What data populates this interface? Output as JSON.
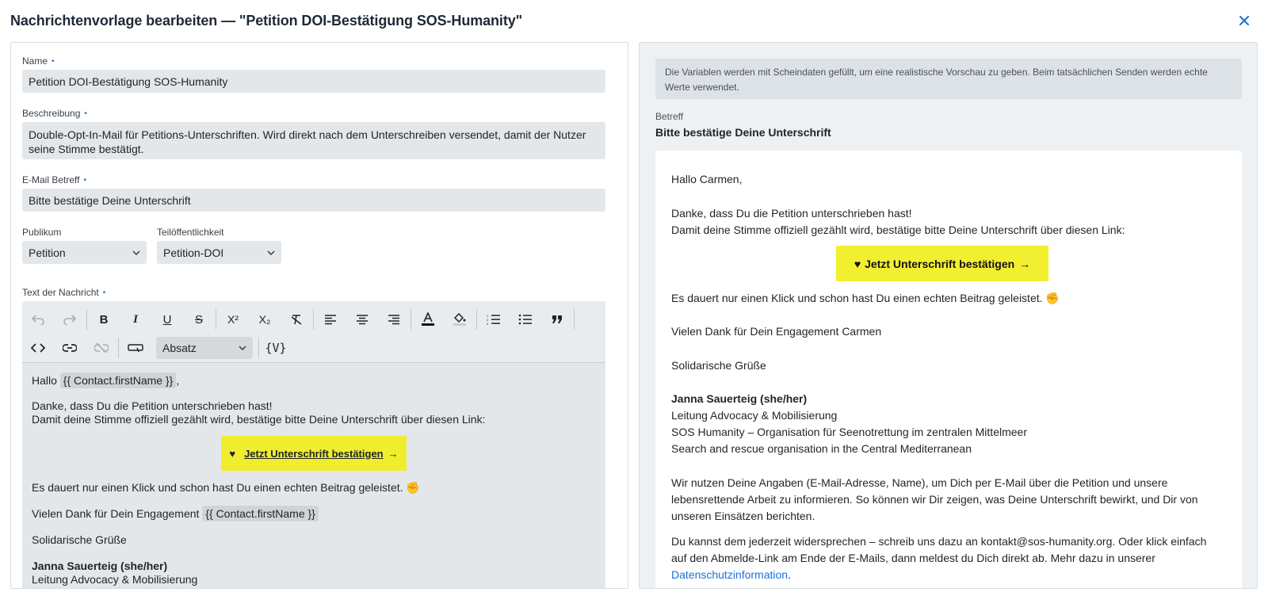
{
  "modal": {
    "title": "Nachrichtenvorlage bearbeiten — \"Petition DOI-Bestätigung SOS-Humanity\"",
    "close_label": "×"
  },
  "form": {
    "name": {
      "label": "Name",
      "value": "Petition DOI-Bestätigung SOS-Humanity"
    },
    "description": {
      "label": "Beschreibung",
      "value": "Double-Opt-In-Mail für Petitions-Unterschriften. Wird direkt nach dem Unterschreiben versendet, damit der Nutzer seine Stimme bestätigt."
    },
    "subject": {
      "label": "E-Mail Betreff",
      "value": "Bitte bestätige Deine Unterschrift"
    },
    "audience": {
      "label": "Publikum",
      "value": "Petition"
    },
    "visibility": {
      "label": "Teilöffentlichkeit",
      "value": "Petition-DOI"
    },
    "body_label": "Text der Nachricht",
    "required_marker": "•"
  },
  "editor": {
    "toolbar": {
      "undo": "↶",
      "redo": "↷",
      "bold": "B",
      "italic": "I",
      "underline": "U",
      "strike": "S",
      "superscript": "X²",
      "subscript": "X₂",
      "clear_format": "T̸",
      "color_icon": "A",
      "block_format": "Absatz",
      "variable": "{V}"
    },
    "content": {
      "greeting_prefix": "Hallo",
      "greeting_var": "{{ Contact.firstName }}",
      "greeting_suffix": ",",
      "line1": "Danke, dass Du die Petition unterschrieben hast!",
      "line2": "Damit deine Stimme offiziell gezählt wird, bestätige bitte Deine Unterschrift über diesen Link:",
      "cta_heart": "♥",
      "cta_label": "Jetzt Unterschrift bestätigen",
      "cta_arrow": "→",
      "line3": "Es dauert nur einen Klick und schon hast Du einen echten Beitrag geleistet. ✊",
      "thanks_prefix": "Vielen Dank für Dein Engagement",
      "thanks_var": "{{ Contact.firstName }}",
      "regards": "Solidarische Grüße",
      "signer_name": "Janna Sauerteig (she/her)",
      "signer_role": "Leitung Advocacy & Mobilisierung"
    }
  },
  "preview": {
    "info": "Die Variablen werden mit Scheindaten gefüllt, um eine realistische Vorschau zu geben. Beim tatsächlichen Senden werden echte Werte verwendet.",
    "subject_label": "Betreff",
    "subject_value": "Bitte bestätige Deine Unterschrift",
    "greeting": "Hallo Carmen,",
    "line1": "Danke, dass Du die Petition unterschrieben hast!",
    "line2": "Damit deine Stimme offiziell gezählt wird, bestätige bitte Deine Unterschrift über diesen Link:",
    "cta_heart": "♥",
    "cta_label": "Jetzt Unterschrift bestätigen",
    "cta_arrow": "→",
    "line3": "Es dauert nur einen Klick und schon hast Du einen echten Beitrag geleistet. ✊",
    "thanks": "Vielen Dank für Dein Engagement Carmen",
    "regards": "Solidarische Grüße",
    "signer_name": "Janna Sauerteig (she/her)",
    "signer_role": "Leitung Advocacy & Mobilisierung",
    "org_de": "SOS Humanity – Organisation für Seenotrettung im zentralen Mittelmeer",
    "org_en": "Search and rescue organisation in the Central Mediterranean",
    "privacy1": "Wir nutzen Deine Angaben (E-Mail-Adresse, Name), um Dich per E-Mail über die Petition und unsere lebensrettende Arbeit zu informieren. So können wir Dir zeigen, was Deine Unterschrift bewirkt, und Dir von unseren Einsätzen berichten.",
    "privacy2": "Du kannst dem jederzeit widersprechen – schreib uns dazu an kontakt@sos-humanity.org. Oder klick einfach auf den Abmelde-Link am Ende der E-Mails, dann meldest du Dich direkt ab. Mehr dazu in unserer",
    "privacy_link": "Datenschutzinformation",
    "privacy_end": "."
  }
}
